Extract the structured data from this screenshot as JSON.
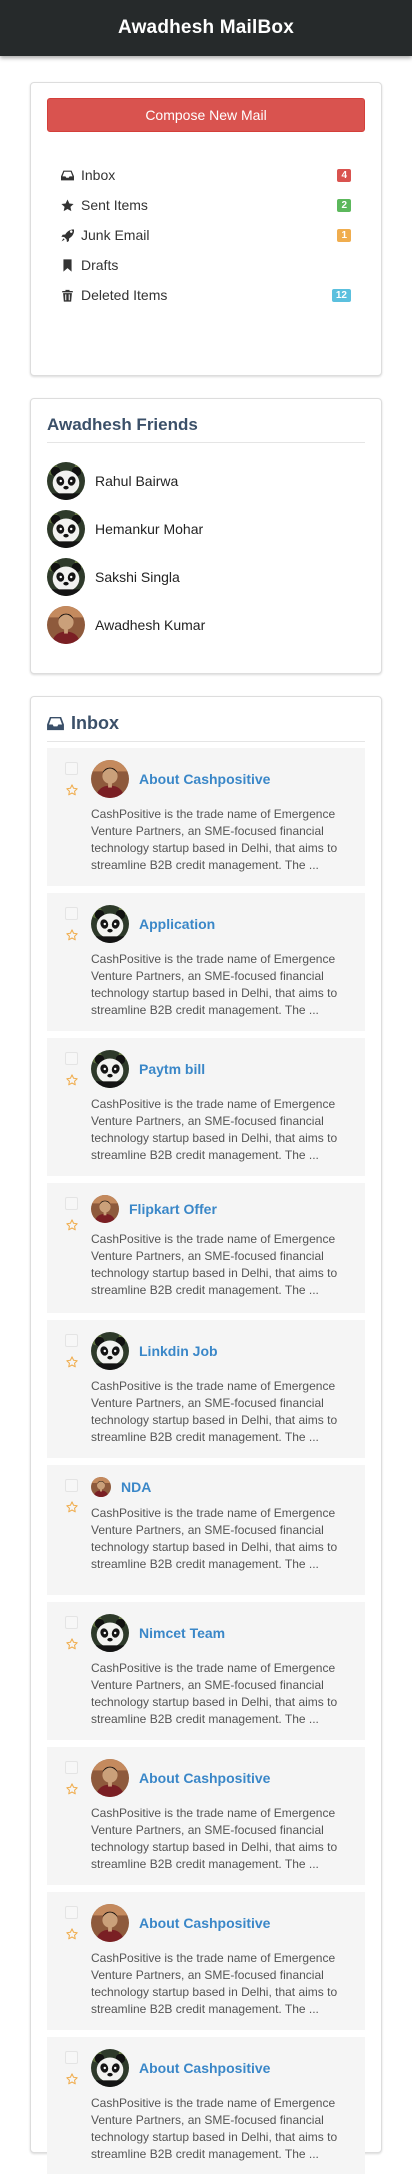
{
  "header": {
    "title": "Awadhesh MailBox"
  },
  "menu": {
    "compose_label": "Compose New Mail",
    "items": [
      {
        "label": "Inbox",
        "icon": "inbox-icon",
        "badge": "4",
        "badge_color": "#d9534f"
      },
      {
        "label": "Sent Items",
        "icon": "star-icon",
        "badge": "2",
        "badge_color": "#5cb85c"
      },
      {
        "label": "Junk Email",
        "icon": "rocket-icon",
        "badge": "1",
        "badge_color": "#f0ad4e"
      },
      {
        "label": "Drafts",
        "icon": "bookmark-icon",
        "badge": "",
        "badge_color": ""
      },
      {
        "label": "Deleted Items",
        "icon": "trash-icon",
        "badge": "12",
        "badge_color": "#5bc0de"
      }
    ]
  },
  "friends": {
    "title": "Awadhesh Friends",
    "items": [
      {
        "name": "Rahul Bairwa",
        "avatar": "panda-avatar"
      },
      {
        "name": "Hemankur Mohar",
        "avatar": "panda-avatar"
      },
      {
        "name": "Sakshi Singla",
        "avatar": "panda-avatar"
      },
      {
        "name": "Awadhesh Kumar",
        "avatar": "person-avatar"
      }
    ]
  },
  "inbox": {
    "title": "Inbox",
    "mails": [
      {
        "subject": "About Cashpositive",
        "avatar": "person-avatar",
        "avatar_size": "large",
        "body": "CashPositive is the trade name of Emergence Venture Partners, an SME-focused financial technology startup based in Delhi, that aims to streamline B2B credit management. The ..."
      },
      {
        "subject": "Application",
        "avatar": "panda-avatar",
        "avatar_size": "large",
        "body": "CashPositive is the trade name of Emergence Venture Partners, an SME-focused financial technology startup based in Delhi, that aims to streamline B2B credit management. The ..."
      },
      {
        "subject": "Paytm bill",
        "avatar": "panda-avatar",
        "avatar_size": "large",
        "body": "CashPositive is the trade name of Emergence Venture Partners, an SME-focused financial technology startup based in Delhi, that aims to streamline B2B credit management. The ..."
      },
      {
        "subject": "Flipkart Offer",
        "avatar": "person-avatar",
        "avatar_size": "medium",
        "body": "CashPositive is the trade name of Emergence Venture Partners, an SME-focused financial technology startup based in Delhi, that aims to streamline B2B credit management. The ..."
      },
      {
        "subject": "Linkdin Job",
        "avatar": "panda-avatar",
        "avatar_size": "large",
        "body": "CashPositive is the trade name of Emergence Venture Partners, an SME-focused financial technology startup based in Delhi, that aims to streamline B2B credit management. The ..."
      },
      {
        "subject": "NDA",
        "avatar": "person-avatar",
        "avatar_size": "small",
        "body": "CashPositive is the trade name of Emergence Venture Partners, an SME-focused financial technology startup based in Delhi, that aims to streamline B2B credit management. The ..."
      },
      {
        "subject": "Nimcet Team",
        "avatar": "panda-avatar",
        "avatar_size": "large",
        "body": "CashPositive is the trade name of Emergence Venture Partners, an SME-focused financial technology startup based in Delhi, that aims to streamline B2B credit management. The ..."
      },
      {
        "subject": "About Cashpositive",
        "avatar": "person-avatar",
        "avatar_size": "large",
        "body": "CashPositive is the trade name of Emergence Venture Partners, an SME-focused financial technology startup based in Delhi, that aims to streamline B2B credit management. The ..."
      },
      {
        "subject": "About Cashpositive",
        "avatar": "person-avatar",
        "avatar_size": "large",
        "body": "CashPositive is the trade name of Emergence Venture Partners, an SME-focused financial technology startup based in Delhi, that aims to streamline B2B credit management. The ..."
      },
      {
        "subject": "About Cashpositive",
        "avatar": "panda-avatar",
        "avatar_size": "large",
        "body": "CashPositive is the trade name of Emergence Venture Partners, an SME-focused financial technology startup based in Delhi, that aims to streamline B2B credit management. The ..."
      }
    ]
  },
  "colors": {
    "header_bg": "#262a2b",
    "compose_bg": "#d9534f",
    "subject": "#3a87c8",
    "panel_title": "#3b5069",
    "star": "#f0ad4e"
  }
}
